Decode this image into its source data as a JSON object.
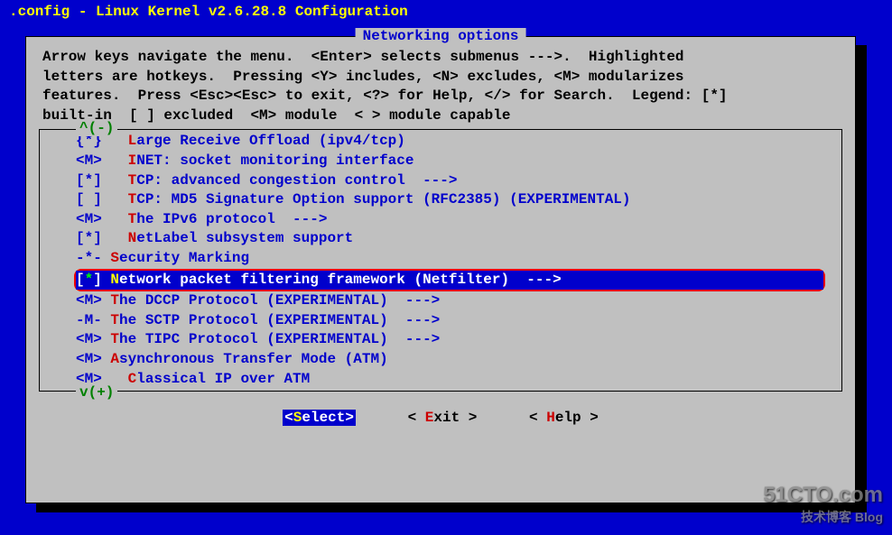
{
  "title": ".config - Linux Kernel v2.6.28.8 Configuration",
  "dialog_title": "Networking options",
  "help_line1": "Arrow keys navigate the menu.  <Enter> selects submenus --->.  Highlighted",
  "help_line2": "letters are hotkeys.  Pressing <Y> includes, <N> excludes, <M> modularizes",
  "help_line3": "features.  Press <Esc><Esc> to exit, <?> for Help, </> for Search.  Legend: [*]",
  "help_line4": "built-in  [ ] excluded  <M> module  < > module capable",
  "scroll_up": "^(-)",
  "scroll_down": "v(+)",
  "items": {
    "i0": {
      "bracket": "{*}   ",
      "hk": "L",
      "label": "arge Receive Offload (ipv4/tcp)"
    },
    "i1": {
      "bracket": "<M>   ",
      "hk": "I",
      "label": "NET: socket monitoring interface"
    },
    "i2": {
      "bracket": "[*]   ",
      "hk": "T",
      "label": "CP: advanced congestion control  --->"
    },
    "i3": {
      "bracket": "[ ]   ",
      "hk": "T",
      "label": "CP: MD5 Signature Option support (RFC2385) (EXPERIMENTAL)"
    },
    "i4": {
      "bracket": "<M>   ",
      "hk": "T",
      "label": "he IPv6 protocol  --->"
    },
    "i5": {
      "bracket": "[*]   ",
      "hk": "N",
      "label": "etLabel subsystem support"
    },
    "i6": {
      "bracket": "-*- ",
      "hk": "S",
      "label": "ecurity Marking"
    },
    "i7": {
      "b1": "[",
      "star": "*",
      "b2": "] ",
      "hk": "N",
      "label": "etwork packet filtering framework (Netfilter)  --->"
    },
    "i8": {
      "bracket": "<M> ",
      "hk": "T",
      "label": "he DCCP Protocol (EXPERIMENTAL)  --->"
    },
    "i9": {
      "bracket": "-M- ",
      "hk": "T",
      "label": "he SCTP Protocol (EXPERIMENTAL)  --->"
    },
    "i10": {
      "bracket": "<M> ",
      "hk": "T",
      "label": "he TIPC Protocol (EXPERIMENTAL)  --->"
    },
    "i11": {
      "bracket": "<M> ",
      "hk": "A",
      "label": "synchronous Transfer Mode (ATM)"
    },
    "i12": {
      "bracket": "<M>   ",
      "hk": "C",
      "label": "lassical IP over ATM"
    }
  },
  "buttons": {
    "select": {
      "prefix": "<",
      "hk": "S",
      "suffix": "elect>"
    },
    "exit": {
      "prefix": "< ",
      "hk": "E",
      "suffix": "xit >"
    },
    "help": {
      "prefix": "< ",
      "hk": "H",
      "suffix": "elp >"
    }
  },
  "watermark": {
    "main": "51CTO.com",
    "sub": "技术博客  Blog"
  }
}
